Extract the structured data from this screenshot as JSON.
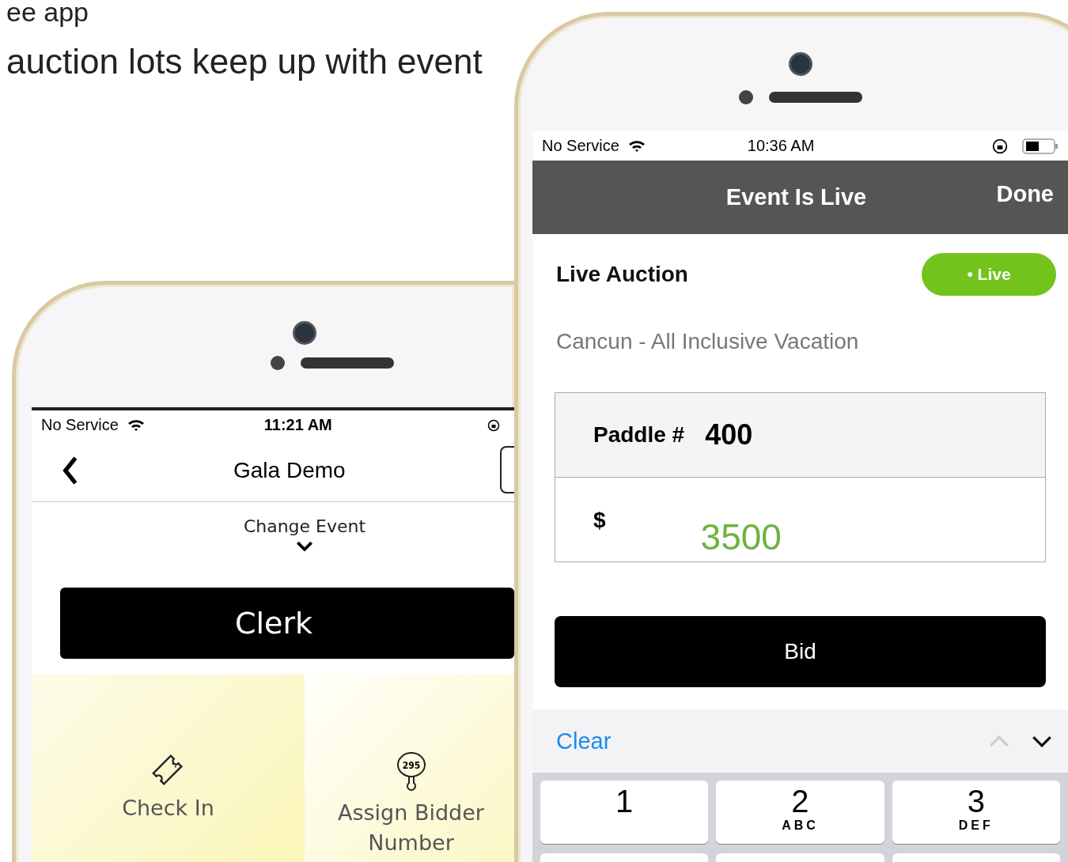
{
  "heading": {
    "line_1": "ee app",
    "line_2": "auction lots keep up with event"
  },
  "phone_left": {
    "status_bar": {
      "carrier": "No Service",
      "time": "11:21 AM"
    },
    "nav": {
      "title": "Gala Demo"
    },
    "change_event": "Change Event",
    "role_button": "Clerk",
    "tiles": [
      {
        "label": "Check In",
        "kind": "ticket"
      },
      {
        "label": "Assign Bidder Number",
        "kind": "paddle",
        "badge": "295"
      }
    ]
  },
  "phone_right": {
    "status_bar": {
      "carrier": "No Service",
      "time": "10:36 AM"
    },
    "nav": {
      "title": "Event Is Live",
      "action": "Done"
    },
    "section_title": "Live Auction",
    "live_badge": "• Live",
    "lot_name": "Cancun - All Inclusive Vacation",
    "paddle": {
      "label": "Paddle #",
      "value": "400"
    },
    "amount": {
      "label": "$",
      "value": "3500"
    },
    "bid_button": "Bid",
    "toolbar": {
      "clear": "Clear",
      "previous_disabled": true
    },
    "keys": [
      {
        "digit": "1"
      },
      {
        "digit": "2",
        "letters": "ABC"
      },
      {
        "digit": "3",
        "letters": "DEF"
      }
    ]
  }
}
